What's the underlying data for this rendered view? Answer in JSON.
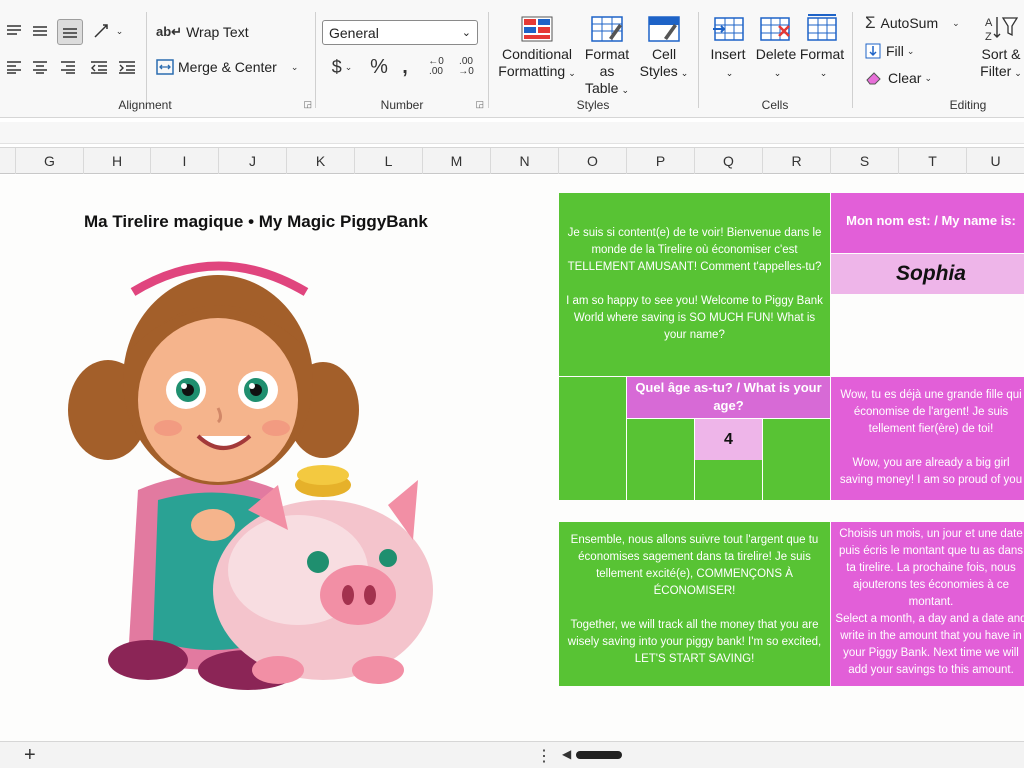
{
  "ribbon": {
    "alignment": {
      "wrap_text": "Wrap Text",
      "merge_center": "Merge & Center",
      "group_label": "Alignment"
    },
    "number": {
      "format_value": "General",
      "group_label": "Number"
    },
    "styles": {
      "conditional_1": "Conditional",
      "conditional_2": "Formatting",
      "format_table_1": "Format as",
      "format_table_2": "Table",
      "cell_styles_1": "Cell",
      "cell_styles_2": "Styles",
      "group_label": "Styles"
    },
    "cells": {
      "insert": "Insert",
      "delete": "Delete",
      "format": "Format",
      "group_label": "Cells"
    },
    "editing": {
      "autosum": "AutoSum",
      "fill": "Fill",
      "clear": "Clear",
      "sort_1": "Sort &",
      "sort_2": "Filter",
      "group_label": "Editing"
    }
  },
  "columns": [
    "G",
    "H",
    "I",
    "J",
    "K",
    "L",
    "M",
    "N",
    "O",
    "P",
    "Q",
    "R",
    "S",
    "T",
    "U"
  ],
  "sheet": {
    "title": "Ma Tirelire magique • My Magic PiggyBank",
    "welcome_fr": "Je suis si content(e) de te voir! Bienvenue dans le monde de la Tirelire où économiser c'est TELLEMENT AMUSANT! Comment t'appelles-tu?",
    "welcome_en": "I am so happy to see you! Welcome to Piggy Bank World where saving is SO MUCH FUN! What is your name?",
    "name_label": "Mon nom est: / My name is:",
    "name_value": "Sophia",
    "age_label": "Quel âge as-tu? / What is your age?",
    "age_value": "4",
    "praise_fr": "Wow, tu es déjà une grande fille qui économise de l'argent! Je suis tellement fier(ère) de toi!",
    "praise_en": "Wow, you are already a big girl saving money! I am so proud of you",
    "together_fr": "Ensemble, nous allons suivre tout l'argent que tu économises sagement dans ta tirelire! Je suis tellement excité(e), COMMENÇONS À ÉCONOMISER!",
    "together_en": "Together, we will track all the money that you are wisely saving into your piggy bank! I'm so excited, LET'S START SAVING!",
    "choose_fr": "Choisis un mois, un jour et une date puis écris le montant que tu as dans ta tirelire. La prochaine fois, nous ajouterons tes économies à ce montant.",
    "choose_en": "Select a month, a day and a date and write in the amount that you have in your Piggy Bank. Next time we will add your savings to this amount."
  },
  "statusbar": {
    "add_sheet": "+"
  },
  "colors": {
    "green": "#58c334",
    "pink": "#e25fd8",
    "light_pink": "#eeb5e9"
  }
}
